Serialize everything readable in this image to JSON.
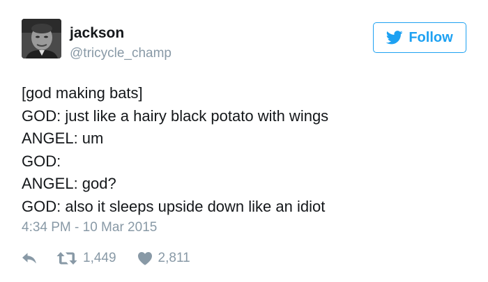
{
  "user": {
    "display_name": "jackson",
    "handle": "@tricycle_champ"
  },
  "follow_button": {
    "label": "Follow",
    "icon": "twitter-bird-icon",
    "color": "#1da1f2"
  },
  "tweet": {
    "lines": [
      "[god making bats]",
      "GOD: just like a hairy black potato with wings",
      "ANGEL: um",
      "GOD:",
      "ANGEL: god?",
      "GOD: also it sleeps upside down like an idiot"
    ],
    "timestamp": "4:34 PM - 10 Mar 2015"
  },
  "actions": {
    "reply": {
      "icon": "reply-icon"
    },
    "retweet": {
      "icon": "retweet-icon",
      "count": "1,449"
    },
    "like": {
      "icon": "heart-icon",
      "count": "2,811"
    }
  },
  "colors": {
    "text": "#14171a",
    "muted": "#8899a6",
    "accent": "#1da1f2"
  }
}
